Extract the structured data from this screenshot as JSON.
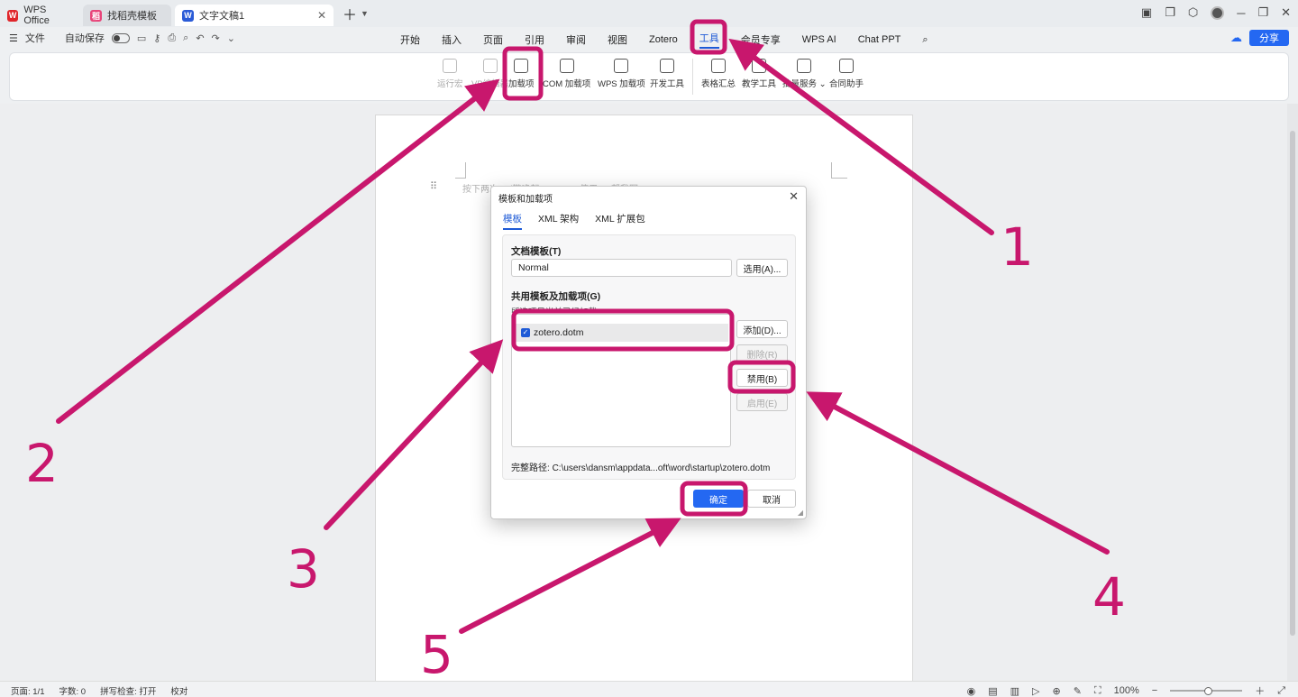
{
  "window": {
    "tabs": [
      {
        "label": "WPS Office"
      },
      {
        "label": "找稻壳模板"
      },
      {
        "label": "文字文稿1"
      }
    ]
  },
  "menubar": {
    "file": "文件",
    "autosave": "自动保存",
    "tabs": [
      "开始",
      "插入",
      "页面",
      "引用",
      "审阅",
      "视图",
      "Zotero",
      "工具",
      "会员专享",
      "WPS AI",
      "Chat PPT"
    ],
    "active_tab": "工具",
    "share": "分享"
  },
  "ribbon": {
    "items": [
      "运行宏",
      "VB编辑器",
      "加载项",
      "COM 加载项",
      "WPS 加载项",
      "开发工具",
      "表格汇总",
      "教学工具",
      "批量服务",
      "合同助手"
    ]
  },
  "document": {
    "hint": "按下两次Ctrl键唤起WPS AI，使用 AI 帮我写"
  },
  "dialog": {
    "title": "模板和加载项",
    "tabs": [
      "模板",
      "XML 架构",
      "XML 扩展包"
    ],
    "doc_template_label": "文档模板(T)",
    "doc_template_value": "Normal",
    "select_button": "选用(A)...",
    "shared_label": "共用模板及加载项(G)",
    "shared_hint": "所选项目当前已经加载",
    "items": [
      {
        "name": "zotero.dotm",
        "checked": true
      }
    ],
    "add_button": "添加(D)...",
    "remove_button": "删除(R)",
    "disable_button": "禁用(B)",
    "enable_button": "启用(E)",
    "path_label": "完整路径:",
    "path_value": "C:\\users\\dansm\\appdata...oft\\word\\startup\\zotero.dotm",
    "ok_button": "确定",
    "cancel_button": "取消"
  },
  "statusbar": {
    "page": "页面: 1/1",
    "words": "字数: 0",
    "spell": "拼写检查: 打开",
    "proof": "校对",
    "zoom": "100%"
  },
  "annotations": {
    "numbers": [
      "1",
      "2",
      "3",
      "4",
      "5"
    ],
    "color": "#c8176d"
  }
}
